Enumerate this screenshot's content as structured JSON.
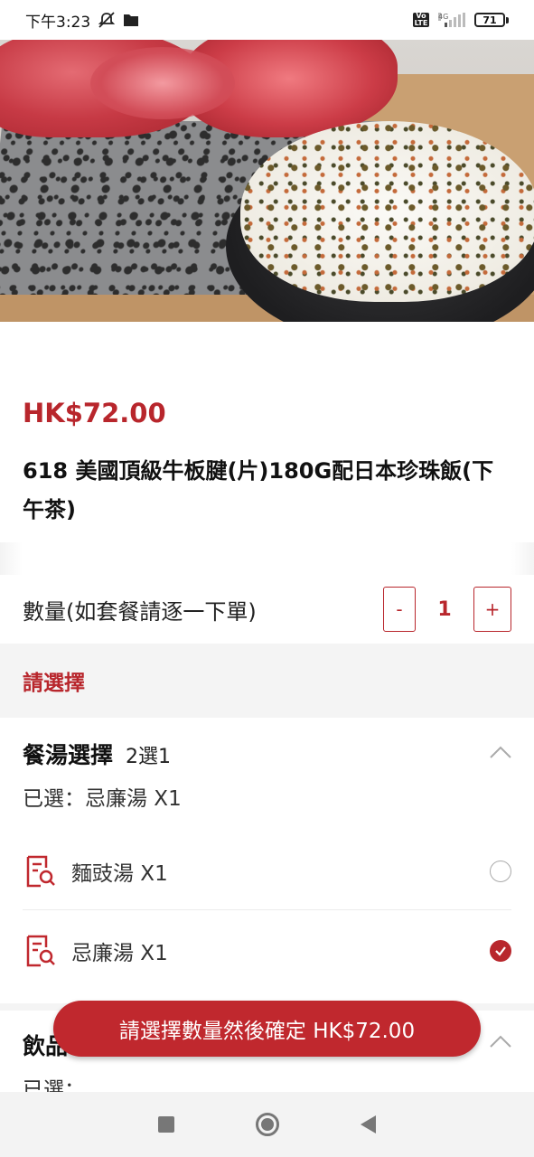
{
  "status_bar": {
    "time": "下午3:23",
    "network": "4G",
    "volte": "Vo LTE",
    "battery": "71"
  },
  "product": {
    "price": "HK$72.00",
    "title": "618 美國頂級牛板腱(片)180G配日本珍珠飯(下午茶)"
  },
  "quantity": {
    "label": "數量(如套餐請逐一下單)",
    "minus": "-",
    "value": "1",
    "plus": "+"
  },
  "section_header": "請選擇",
  "soup_group": {
    "name": "餐湯選擇",
    "rule": "2選1",
    "selected": "已選：忌廉湯 X1",
    "options": [
      {
        "label": "麵豉湯 X1",
        "selected": false
      },
      {
        "label": "忌廉湯 X1",
        "selected": true
      }
    ]
  },
  "drink_group": {
    "name": "飲品",
    "selected": "已選："
  },
  "cta": {
    "label": "請選擇數量然後確定 HK$72.00"
  },
  "colors": {
    "accent": "#b8262c",
    "cta_bg": "#c0282e"
  }
}
